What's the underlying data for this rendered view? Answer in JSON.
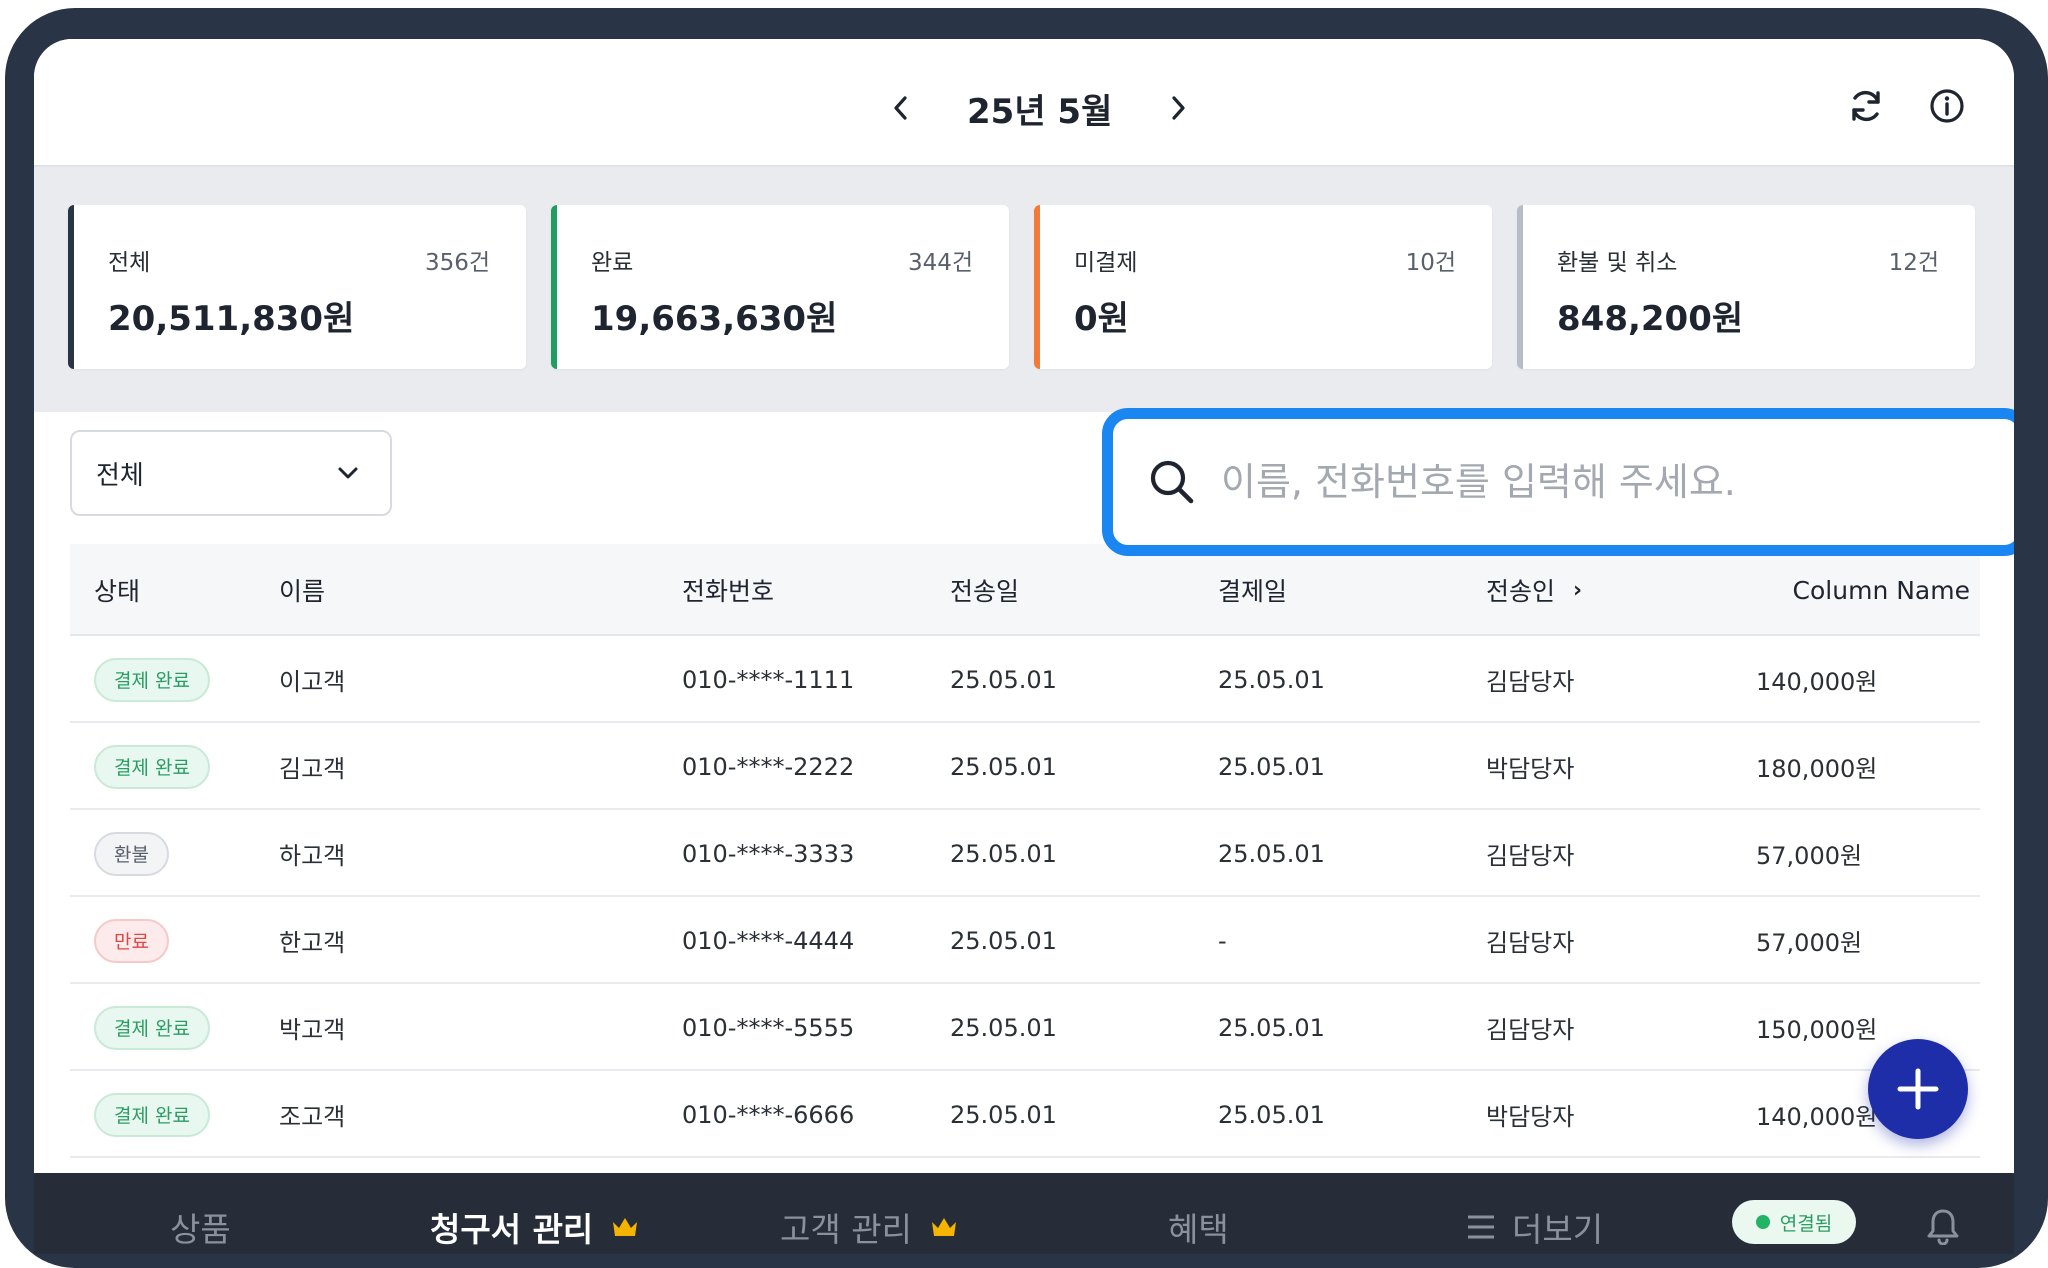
{
  "header": {
    "month_title": "25년 5월"
  },
  "summary": [
    {
      "label": "전체",
      "count": "356건",
      "amount": "20,511,830원",
      "color": "#2a3447"
    },
    {
      "label": "완료",
      "count": "344건",
      "amount": "19,663,630원",
      "color": "#1f9d63"
    },
    {
      "label": "미결제",
      "count": "10건",
      "amount": "0원",
      "color": "#f27a3a"
    },
    {
      "label": "환불 및 취소",
      "count": "12건",
      "amount": "848,200원",
      "color": "#b8bcc4"
    }
  ],
  "filter": {
    "selected": "전체"
  },
  "search": {
    "placeholder": "이름, 전화번호를 입력해 주세요."
  },
  "table": {
    "columns": [
      "상태",
      "이름",
      "전화번호",
      "전송일",
      "결제일",
      "전송인",
      "Column Name"
    ],
    "rows": [
      {
        "status": "결제 완료",
        "status_type": "done",
        "name": "이고객",
        "phone": "010-****-1111",
        "sent": "25.05.01",
        "paid": "25.05.01",
        "sender": "김담당자",
        "amount": "140,000원"
      },
      {
        "status": "결제 완료",
        "status_type": "done",
        "name": "김고객",
        "phone": "010-****-2222",
        "sent": "25.05.01",
        "paid": "25.05.01",
        "sender": "박담당자",
        "amount": "180,000원"
      },
      {
        "status": "환불",
        "status_type": "refund",
        "name": "하고객",
        "phone": "010-****-3333",
        "sent": "25.05.01",
        "paid": "25.05.01",
        "sender": "김담당자",
        "amount": "57,000원"
      },
      {
        "status": "만료",
        "status_type": "expired",
        "name": "한고객",
        "phone": "010-****-4444",
        "sent": "25.05.01",
        "paid": "-",
        "sender": "김담당자",
        "amount": "57,000원"
      },
      {
        "status": "결제 완료",
        "status_type": "done",
        "name": "박고객",
        "phone": "010-****-5555",
        "sent": "25.05.01",
        "paid": "25.05.01",
        "sender": "김담당자",
        "amount": "150,000원"
      },
      {
        "status": "결제 완료",
        "status_type": "done",
        "name": "조고객",
        "phone": "010-****-6666",
        "sent": "25.05.01",
        "paid": "25.05.01",
        "sender": "박담당자",
        "amount": "140,000원"
      }
    ]
  },
  "bottom_nav": {
    "items": [
      {
        "label": "상품"
      },
      {
        "label": "청구서 관리"
      },
      {
        "label": "고객 관리"
      },
      {
        "label": "혜택"
      },
      {
        "label": "더보기"
      }
    ],
    "connection": "연결됨"
  },
  "icons": {
    "prev": "chevron-left-icon",
    "next": "chevron-right-icon",
    "refresh": "refresh-icon",
    "info": "info-icon",
    "search": "search-icon",
    "dropdown": "chevron-down-icon",
    "add": "plus-icon",
    "crown": "crown-icon",
    "menu": "menu-icon",
    "bell": "bell-icon"
  },
  "colors": {
    "accent": "#1a86f2",
    "fab": "#1e2ea8",
    "success": "#2a9d63",
    "danger": "#e04848"
  }
}
